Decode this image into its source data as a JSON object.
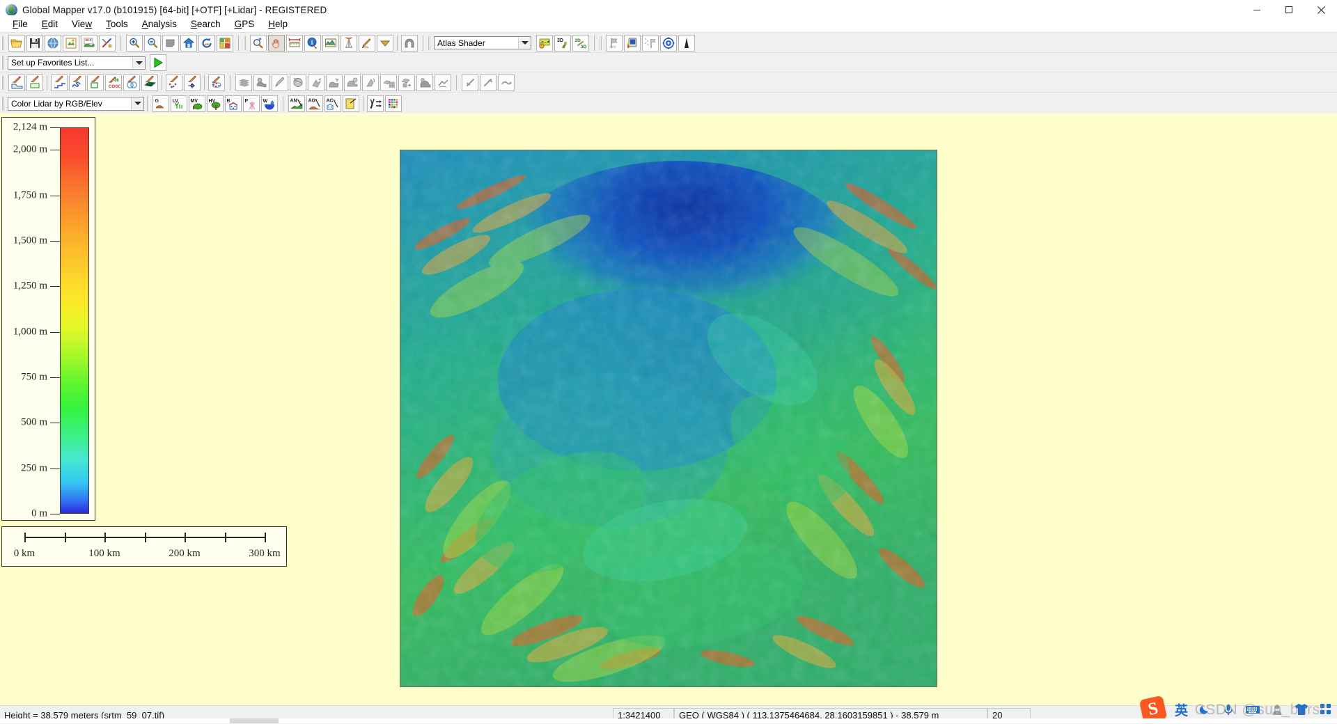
{
  "window": {
    "title": "Global Mapper v17.0 (b101915) [64-bit] [+OTF] [+Lidar] - REGISTERED",
    "app_icon": "globe-icon",
    "minimize": "minimize-button",
    "maximize": "maximize-button",
    "close": "close-button"
  },
  "menubar": {
    "items": [
      {
        "label": "File",
        "mnemonic": "F"
      },
      {
        "label": "Edit",
        "mnemonic": "E"
      },
      {
        "label": "View",
        "mnemonic": "w"
      },
      {
        "label": "Tools",
        "mnemonic": "T"
      },
      {
        "label": "Analysis",
        "mnemonic": "A"
      },
      {
        "label": "Search",
        "mnemonic": "S"
      },
      {
        "label": "GPS",
        "mnemonic": "G"
      },
      {
        "label": "Help",
        "mnemonic": "H"
      }
    ]
  },
  "toolbar_file": {
    "buttons": [
      {
        "name": "open-file-icon",
        "tip": "Open Data File"
      },
      {
        "name": "save-workspace-icon",
        "tip": "Save Workspace"
      },
      {
        "name": "open-online-data-icon",
        "tip": "Connect to Online Data"
      },
      {
        "name": "open-control-center-icon",
        "tip": "Open Control Center"
      },
      {
        "name": "open-all-data-icon",
        "tip": "Open All Files in Folder"
      },
      {
        "name": "configuration-icon",
        "tip": "Configuration"
      }
    ]
  },
  "toolbar_view": {
    "buttons": [
      {
        "name": "zoom-in-icon",
        "tip": "Zoom In"
      },
      {
        "name": "zoom-out-icon",
        "tip": "Zoom Out"
      },
      {
        "name": "zoom-to-selection-icon",
        "tip": "Zoom to Saved View"
      },
      {
        "name": "full-view-icon",
        "tip": "Full View"
      },
      {
        "name": "refresh-icon",
        "tip": "Redraw"
      },
      {
        "name": "layout-icon",
        "tip": "Map Layout"
      }
    ]
  },
  "toolbar_tools": {
    "buttons": [
      {
        "name": "zoom-tool-icon",
        "tip": "Zoom Tool"
      },
      {
        "name": "pan-hand-icon",
        "tip": "Pan Tool",
        "active": true
      },
      {
        "name": "measure-icon",
        "tip": "Measure Tool"
      },
      {
        "name": "feature-info-icon",
        "tip": "Feature Info Tool"
      },
      {
        "name": "path-profile-icon",
        "tip": "Path Profile / LOS"
      },
      {
        "name": "view-shed-icon",
        "tip": "View Shed Tool"
      },
      {
        "name": "digitizer-pencil-icon",
        "tip": "Digitizer Tool"
      },
      {
        "name": "dropdown-arrow-icon",
        "tip": "More Tools"
      },
      {
        "name": "tunnel-icon",
        "tip": "Coordinate Convertor"
      }
    ]
  },
  "shader": {
    "selected": "Atlas Shader",
    "placeholder": "Atlas Shader",
    "buttons": [
      {
        "name": "shader-options-icon",
        "tip": "Shader Options"
      },
      {
        "name": "3d-view-icon",
        "tip": "Show 3D View"
      },
      {
        "name": "2d-3d-link-icon",
        "tip": "Link 2D and 3D Views"
      }
    ]
  },
  "toolbar_gps": {
    "buttons": [
      {
        "name": "flag-gray-icon",
        "tip": "Start GPS Tracking"
      },
      {
        "name": "gps-device-icon",
        "tip": "GPS Setup"
      },
      {
        "name": "flag-markers-icon",
        "tip": "Clear Track"
      },
      {
        "name": "gps-center-icon",
        "tip": "Center on GPS"
      },
      {
        "name": "antenna-icon",
        "tip": "GPS Antenna"
      }
    ]
  },
  "favorites": {
    "selected": "Set up Favorites List...",
    "run_button": "run-favorite-button",
    "run_icon": "play-triangle-icon"
  },
  "toolbar_digitizer": {
    "buttons": [
      {
        "name": "create-area-icon",
        "tip": "Create Area Feature"
      },
      {
        "name": "create-rectangle-icon",
        "tip": "Create Rectangular Area"
      },
      {
        "name": "create-line-icon",
        "tip": "Create Line Feature"
      },
      {
        "name": "create-freehand-icon",
        "tip": "Create Freehand Feature"
      },
      {
        "name": "create-box-icon",
        "tip": "Create Box"
      },
      {
        "name": "create-cogo-icon",
        "tip": "Create COGO Feature"
      },
      {
        "name": "create-buffer-icon",
        "tip": "Create Buffer Area"
      },
      {
        "name": "create-grid-icon",
        "tip": "Create Grid of Features"
      },
      {
        "name": "create-points-icon",
        "tip": "Create Point Features"
      },
      {
        "name": "create-coordinate-point-icon",
        "tip": "Create Point at Coordinate"
      },
      {
        "name": "edit-points-icon",
        "tip": "Edit Point Features"
      },
      {
        "name": "stack-layers-icon",
        "tip": "Layer Operations"
      },
      {
        "name": "combine-areas-icon",
        "tip": "Combine Areas"
      },
      {
        "name": "split-feature-icon",
        "tip": "Split Feature"
      },
      {
        "name": "crop-globe-icon",
        "tip": "Crop / Reproject"
      },
      {
        "name": "move-vertex-icon",
        "tip": "Move Vertex"
      },
      {
        "name": "merge-areas-icon",
        "tip": "Merge Areas"
      },
      {
        "name": "smooth-area-icon",
        "tip": "Smooth Area"
      },
      {
        "name": "rotate-feature-icon",
        "tip": "Rotate Features"
      },
      {
        "name": "attribute-table-icon",
        "tip": "Edit Attributes"
      },
      {
        "name": "copy-features-icon",
        "tip": "Copy Features"
      },
      {
        "name": "delete-feature-icon",
        "tip": "Delete Features"
      },
      {
        "name": "trim-feature-icon",
        "tip": "Trim Features"
      },
      {
        "name": "undo-icon",
        "tip": "Undo"
      },
      {
        "name": "redo-icon",
        "tip": "Redo"
      },
      {
        "name": "reshape-icon",
        "tip": "Reshape"
      }
    ]
  },
  "lidar": {
    "draw_mode_selected": "Color Lidar by RGB/Elev",
    "filter_buttons": [
      {
        "name": "lidar-ground-icon",
        "label": "G",
        "tip": "Ground"
      },
      {
        "name": "lidar-low-veg-icon",
        "label": "LV",
        "tip": "Low Vegetation"
      },
      {
        "name": "lidar-med-veg-icon",
        "label": "MV",
        "tip": "Medium Vegetation"
      },
      {
        "name": "lidar-high-veg-icon",
        "label": "HV",
        "tip": "High Vegetation"
      },
      {
        "name": "lidar-building-icon",
        "label": "B",
        "tip": "Building"
      },
      {
        "name": "lidar-power-icon",
        "label": "P",
        "tip": "Power Line"
      },
      {
        "name": "lidar-water-icon",
        "label": "W",
        "tip": "Water"
      }
    ],
    "analysis_buttons": [
      {
        "name": "auto-classify-noise-icon",
        "label": "AN",
        "tip": "Automatically Classify Noise Points"
      },
      {
        "name": "auto-classify-ground-icon",
        "label": "AG",
        "tip": "Automatically Classify Ground Points"
      },
      {
        "name": "auto-classify-buildings-icon",
        "label": "AC",
        "tip": "Automatically Classify Buildings"
      },
      {
        "name": "apply-color-icon",
        "tip": "Apply Color to Lidar Points"
      },
      {
        "name": "extract-features-icon",
        "tip": "Extract Features"
      },
      {
        "name": "lidar-palette-icon",
        "tip": "Lidar Draw Settings"
      }
    ]
  },
  "legend": {
    "title": "elevation-legend",
    "unit": "m",
    "ticks": [
      {
        "label": "2,124 m",
        "value": 2124
      },
      {
        "label": "2,000 m",
        "value": 2000
      },
      {
        "label": "1,750 m",
        "value": 1750
      },
      {
        "label": "1,500 m",
        "value": 1500
      },
      {
        "label": "1,250 m",
        "value": 1250
      },
      {
        "label": "1,000 m",
        "value": 1000
      },
      {
        "label": "750 m",
        "value": 750
      },
      {
        "label": "500 m",
        "value": 500
      },
      {
        "label": "250 m",
        "value": 250
      },
      {
        "label": "0 m",
        "value": 0
      }
    ],
    "min_value": 0,
    "max_value": 2124,
    "ramp_colors": [
      "#2b2bdd",
      "#35c8f5",
      "#46e8d0",
      "#33f33e",
      "#a8f82a",
      "#e4f82a",
      "#fcb62c",
      "#fa6f2e",
      "#f8372f"
    ]
  },
  "scalebar": {
    "name": "map-scale-bar",
    "labels": [
      "0 km",
      "100 km",
      "200 km",
      "300 km"
    ],
    "tick_count": 7,
    "max_km": 300
  },
  "statusbar": {
    "height_text": "Height = 38.579 meters (srtm_59_07.tif)",
    "scale": "1:3421400",
    "position": "GEO ( WGS84 ) ( 113.1375464684, 28.1603159851 ) - 38.579 m",
    "extra": "20"
  },
  "tray": {
    "items": [
      {
        "name": "sogou-input-icon",
        "label": "S"
      },
      {
        "name": "chinese-input-icon",
        "label": "英"
      },
      {
        "name": "moon-icon",
        "label": "moon"
      },
      {
        "name": "mic-icon",
        "label": "mic"
      },
      {
        "name": "keyboard-icon",
        "label": "keyboard"
      },
      {
        "name": "person-icon",
        "label": "person"
      },
      {
        "name": "shirt-icon",
        "label": "skin"
      },
      {
        "name": "apps-grid-icon",
        "label": "apps"
      }
    ],
    "watermark": "CSDN @sun_burst"
  }
}
